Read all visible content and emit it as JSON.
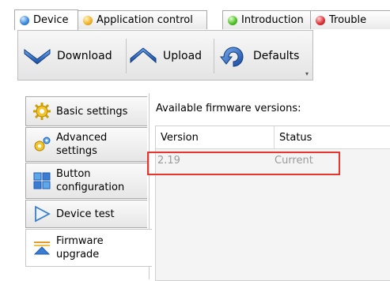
{
  "tabs": [
    {
      "label": "Device",
      "dot": "blue",
      "active": true
    },
    {
      "label": "Application control",
      "dot": "yellow",
      "active": false
    },
    {
      "label": "Introduction",
      "dot": "green",
      "active": false
    },
    {
      "label": "Trouble",
      "dot": "red",
      "active": false
    }
  ],
  "toolbar": {
    "download_label": "Download",
    "upload_label": "Upload",
    "defaults_label": "Defaults",
    "more_glyph": "▾"
  },
  "nav": {
    "items": [
      {
        "label": "Basic settings",
        "icon": "gear-icon"
      },
      {
        "label": "Advanced settings",
        "icon": "gears-icon"
      },
      {
        "label": "Button configuration",
        "icon": "button-config-icon"
      },
      {
        "label": "Device test",
        "icon": "play-icon"
      },
      {
        "label": "Firmware upgrade",
        "icon": "firmware-icon",
        "active": true
      }
    ]
  },
  "firmware": {
    "heading": "Available firmware versions:",
    "columns": [
      "Version",
      "Status"
    ],
    "rows": [
      {
        "version": "2.19",
        "status": "Current"
      }
    ]
  },
  "colors": {
    "highlight": "#e8362f",
    "toolbar_arrow": "#1d5bb5"
  }
}
